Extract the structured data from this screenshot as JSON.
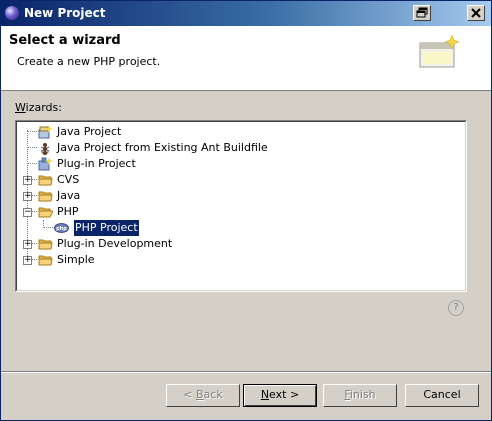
{
  "window": {
    "title": "New Project"
  },
  "header": {
    "title": "Select a wizard",
    "description": "Create a new PHP project."
  },
  "wizards_label": {
    "accel": "W",
    "rest": "izards:"
  },
  "tree": [
    {
      "label": "Java Project",
      "icon": "java-project-icon"
    },
    {
      "label": "Java Project from Existing Ant Buildfile",
      "icon": "ant-icon"
    },
    {
      "label": "Plug-in Project",
      "icon": "plugin-project-icon"
    },
    {
      "label": "CVS",
      "icon": "folder-icon",
      "expander": "+"
    },
    {
      "label": "Java",
      "icon": "folder-icon",
      "expander": "+"
    },
    {
      "label": "PHP",
      "icon": "folder-open-icon",
      "expander": "-"
    },
    {
      "label": "PHP Project",
      "icon": "php-icon",
      "selected": true
    },
    {
      "label": "Plug-in Development",
      "icon": "folder-icon",
      "expander": "+"
    },
    {
      "label": "Simple",
      "icon": "folder-icon",
      "expander": "+"
    }
  ],
  "buttons": {
    "back": {
      "prefix": "< ",
      "mnemonic": "B",
      "rest": "ack"
    },
    "next": {
      "mnemonic": "N",
      "rest": "ext >"
    },
    "finish": {
      "mnemonic": "F",
      "rest": "inish"
    },
    "cancel": {
      "label": "Cancel"
    }
  },
  "colors": {
    "selection": "#0a246a",
    "titlebar_start": "#0a246a",
    "folder": "#e8b54a"
  }
}
